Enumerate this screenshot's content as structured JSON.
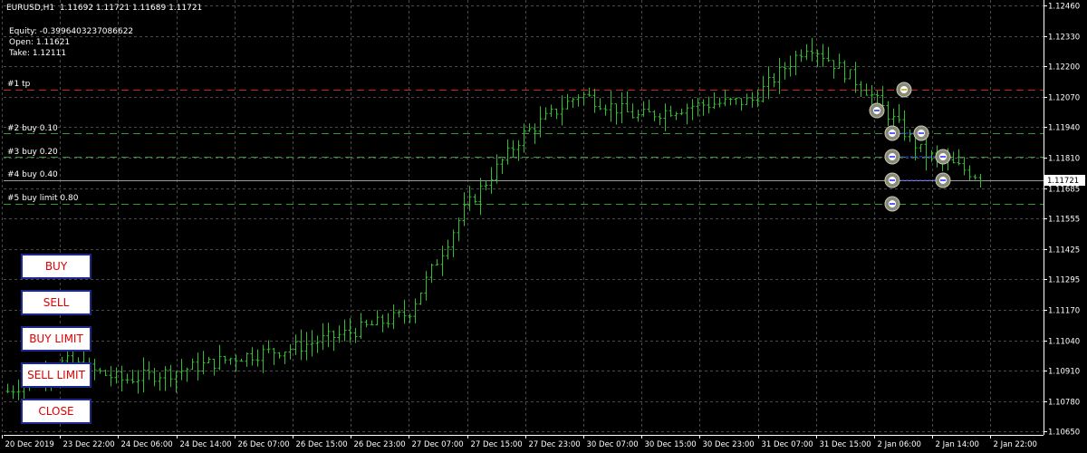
{
  "header": {
    "title": "EURUSD,H1  1.11692 1.11721 1.11689 1.11721",
    "equity": "Equity: -0.3996403237086622",
    "open": "Open: 1.11621",
    "take": "Take: 1.12111"
  },
  "levels": [
    {
      "label": "#1 tp",
      "price": 1.12111,
      "color": "#d02020"
    },
    {
      "label": "#2 buy 0.10",
      "price": 1.1193,
      "color": "#2e9a2e"
    },
    {
      "label": "#3 buy 0.20",
      "price": 1.1182,
      "color": "#2e9a2e"
    },
    {
      "label": "#4 buy 0.40",
      "price": 1.11721,
      "color": "#9a9a9a"
    },
    {
      "label": "#5 buy limit 0.80",
      "price": 1.11621,
      "color": "#2e9a2e"
    }
  ],
  "buttons": {
    "buy": "BUY",
    "sell": "SELL",
    "buy_limit": "BUY LIMIT",
    "sell_limit": "SELL LIMIT",
    "close": "CLOSE"
  },
  "price_axis": {
    "labels": [
      "1.12460",
      "1.12330",
      "1.12200",
      "1.12070",
      "1.11940",
      "1.11810",
      "1.11685",
      "1.11555",
      "1.11425",
      "1.11295",
      "1.11170",
      "1.11040",
      "1.10910",
      "1.10780",
      "1.10650"
    ],
    "current_price": "1.11721"
  },
  "time_axis": {
    "labels": [
      "20 Dec 2019",
      "23 Dec 22:00",
      "24 Dec 06:00",
      "24 Dec 14:00",
      "26 Dec 07:00",
      "26 Dec 15:00",
      "26 Dec 23:00",
      "27 Dec 07:00",
      "27 Dec 15:00",
      "27 Dec 23:00",
      "30 Dec 07:00",
      "30 Dec 15:00",
      "30 Dec 23:00",
      "31 Dec 07:00",
      "31 Dec 15:00",
      "2 Jan 06:00",
      "2 Jan 14:00",
      "2 Jan 22:00"
    ]
  },
  "colors": {
    "background": "#000000",
    "grid": "#4a4a4a",
    "bars": "#2fbf2f",
    "tp_line": "#d02020",
    "buy_line": "#2e9a2e",
    "current_line": "#b0b0b0",
    "button_text": "#e00000",
    "button_border": "#1b2a8c"
  },
  "chart_data": {
    "type": "line",
    "title": "EURUSD,H1",
    "xlabel": "",
    "ylabel": "",
    "ylim": [
      1.1059,
      1.1249
    ],
    "grid": true,
    "x": [
      "20 Dec 2019",
      "23 Dec 22:00",
      "24 Dec 06:00",
      "24 Dec 14:00",
      "26 Dec 07:00",
      "26 Dec 15:00",
      "26 Dec 23:00",
      "27 Dec 07:00",
      "27 Dec 15:00",
      "27 Dec 23:00",
      "30 Dec 07:00",
      "30 Dec 15:00",
      "30 Dec 23:00",
      "31 Dec 07:00",
      "31 Dec 15:00",
      "2 Jan 06:00",
      "2 Jan 14:00",
      "2 Jan 22:00"
    ],
    "series": [
      {
        "values": [
          1.1078,
          1.1091,
          1.1083,
          1.1087,
          1.1093,
          1.1097,
          1.1104,
          1.1112,
          1.1158,
          1.119,
          1.1208,
          1.1198,
          1.1203,
          1.1205,
          1.123,
          1.121,
          1.1182,
          1.1172
        ]
      }
    ]
  }
}
